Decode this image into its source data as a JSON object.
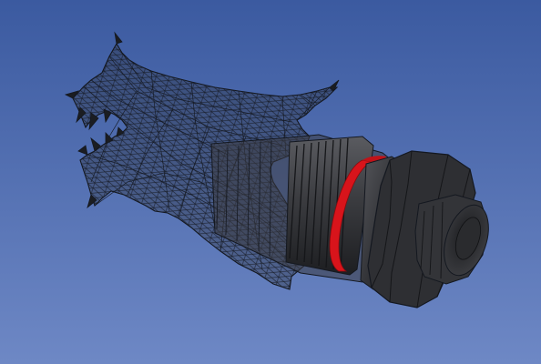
{
  "viewport": {
    "background_top": "#3b5aa0",
    "background_bottom": "#6e88c5"
  },
  "model": {
    "mesh_stroke": "#141820",
    "mesh_fill": "#2a2d34",
    "body_color": "#3a3b3f",
    "body_dark": "#1e1f22",
    "ring_color": "#d8141b",
    "nozzle_color": "#2c2d30"
  }
}
